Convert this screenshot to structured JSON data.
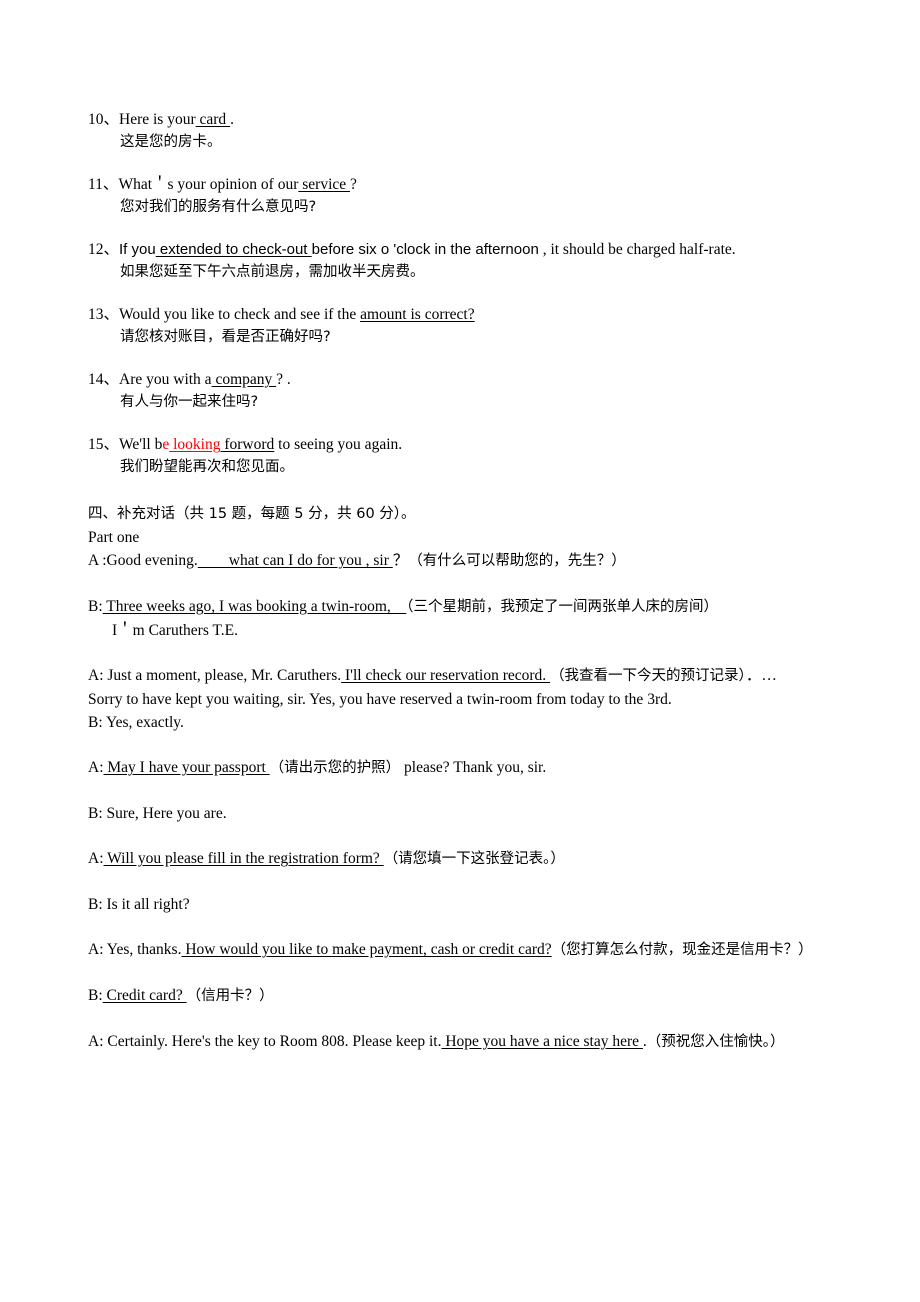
{
  "document": {
    "page_color": "#ffffff",
    "text_color": "#000000",
    "accent_red": "#ff0000"
  },
  "items": [
    {
      "number": "10、",
      "en_before": "Here is your",
      "en_blank": " card ",
      "en_after": ".",
      "zh": "这是您的房卡。"
    },
    {
      "number": "11、",
      "en_before": "What＇s your opinion of our",
      "en_blank": " service ",
      "en_after": "?",
      "zh": "您对我们的服务有什么意见吗?"
    },
    {
      "number": "12、",
      "en_before": "If you",
      "en_blank": " extended to check-out ",
      "en_after": "before six o 'clock in the afternoon",
      "en_tail": " , it should be charged half-rate.",
      "zh": "如果您延至下午六点前退房，需加收半天房费。"
    },
    {
      "number": "13、",
      "en_before": "Would you like to check and see if the ",
      "en_blank": "amount is correct?",
      "en_after": "",
      "zh": "请您核对账目，看是否正确好吗?"
    },
    {
      "number": "14、",
      "en_before": "Are you with a",
      "en_blank": " company ",
      "en_after": "? .",
      "zh": "有人与你一起来住吗?"
    },
    {
      "number": "15、",
      "en_before": "We'll b",
      "en_red_char": "e",
      "en_red_blank": "  looking",
      "en_blank": " forword",
      "en_after": " to seeing you again.",
      "zh": "我们盼望能再次和您见面。"
    }
  ],
  "section": {
    "heading": "四、补充对话（共 15 题，每题 5 分，共 60 分）。",
    "part_label": "Part one"
  },
  "dialogue": [
    {
      "speaker": "A :Good evening.",
      "blank": "　　what can I do for you , sir ",
      "after": "？",
      "zh": "（有什么可以帮助您的，先生？）"
    },
    {
      "speaker": "B:",
      "blank": " Three weeks ago, I was booking a twin-room,　",
      "after": "",
      "zh": "（三个星期前，我预定了一间两张单人床的房间）",
      "second_line": "I＇m Caruthers T.E."
    },
    {
      "speaker": "A: Just a moment, please, Mr. Caruthers.",
      "blank": "  I'll check our reservation record. ",
      "after": "",
      "zh": "（我查看一下今天的预订记录）",
      "tail": "．…",
      "continuation": "Sorry to have kept you waiting, sir. Yes, you have reserved a twin-room from today to the 3rd.",
      "reply": "B: Yes, exactly."
    },
    {
      "speaker": "A:",
      "blank": "  May I have your passport ",
      "after": "",
      "zh": "（请出示您的护照）",
      "tail": " please? Thank you, sir."
    },
    {
      "speaker": "B: Sure, Here you are.",
      "blank": "",
      "after": "",
      "zh": ""
    },
    {
      "speaker": "A:",
      "blank": " Will you please fill in the registration form? ",
      "after": "",
      "zh": "（请您填一下这张登记表。）"
    },
    {
      "speaker": "B: Is it all right?",
      "blank": "",
      "after": "",
      "zh": ""
    },
    {
      "speaker": "A: Yes, thanks.",
      "blank": "  How would you like to make payment, cash or credit card?",
      "after": "",
      "zh": "（您打算怎么付款，现金还是信用卡？）"
    },
    {
      "speaker": "B:",
      "blank": " Credit card? ",
      "after": "",
      "zh": "（信用卡？）"
    },
    {
      "speaker": "A: Certainly. Here's the key to Room 808. Please keep it.",
      "blank": "  Hope you have a nice stay here ",
      "after": ".",
      "zh": "（预祝您入住愉快。）"
    }
  ]
}
